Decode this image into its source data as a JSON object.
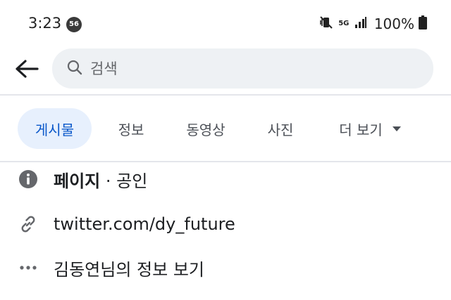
{
  "status_bar": {
    "time": "3:23",
    "notification_count": "56",
    "network_label": "5G",
    "battery": "100%"
  },
  "search": {
    "placeholder": "검색"
  },
  "tabs": [
    {
      "label": "게시물",
      "active": true
    },
    {
      "label": "정보",
      "active": false
    },
    {
      "label": "동영상",
      "active": false
    },
    {
      "label": "사진",
      "active": false
    },
    {
      "label": "더 보기",
      "active": false
    }
  ],
  "info": {
    "page_label": "페이지",
    "separator": "·",
    "category": "공인",
    "link": "twitter.com/dy_future",
    "more_info": "김동연님의 정보 보기"
  },
  "colors": {
    "active_tab_bg": "#e7f0fd",
    "active_tab_text": "#0a58ca",
    "search_bg": "#eef1f4"
  }
}
